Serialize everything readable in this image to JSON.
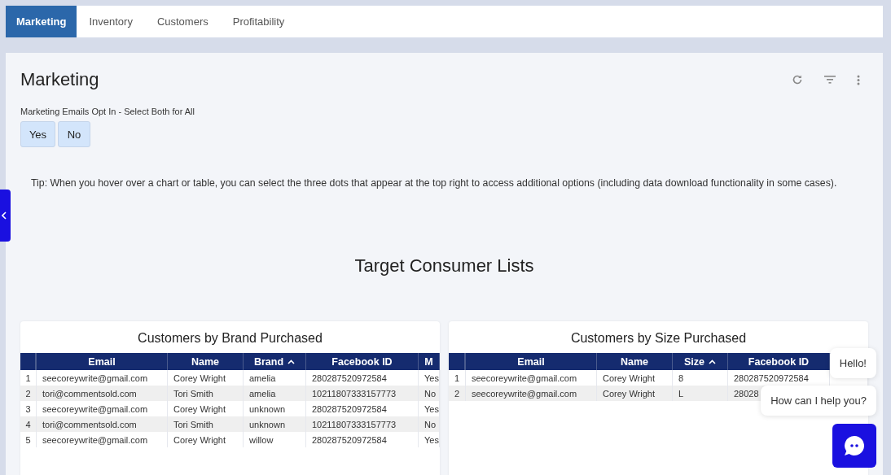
{
  "tabs": [
    {
      "label": "Marketing",
      "selected": true
    },
    {
      "label": "Inventory",
      "selected": false
    },
    {
      "label": "Customers",
      "selected": false
    },
    {
      "label": "Profitability",
      "selected": false
    }
  ],
  "page": {
    "title": "Marketing",
    "filter_label": "Marketing Emails Opt In - Select Both for All",
    "filter_options": [
      {
        "label": "Yes",
        "selected": false
      },
      {
        "label": "No",
        "selected": false
      }
    ],
    "tip": "Tip: When you hover over a chart or table, you can select the three dots that appear at the top right to access additional options (including data download functionality in some cases).",
    "section_title": "Target Consumer Lists"
  },
  "tables": [
    {
      "title": "Customers by Brand Purchased",
      "columns": [
        {
          "sorted": false
        },
        {
          "label": "Email",
          "sorted": false
        },
        {
          "label": "Name",
          "sorted": false
        },
        {
          "label": "Brand",
          "sorted": true
        },
        {
          "label": "Facebook ID",
          "sorted": false
        },
        {
          "label": "M",
          "sorted": false
        }
      ],
      "rows": [
        [
          "1",
          "seecoreywrite@gmail.com",
          "Corey Wright",
          "amelia",
          "280287520972584",
          "Yes"
        ],
        [
          "2",
          "tori@commentsold.com",
          "Tori Smith",
          "amelia",
          "10211807333157773",
          "No"
        ],
        [
          "3",
          "seecoreywrite@gmail.com",
          "Corey Wright",
          "unknown",
          "280287520972584",
          "Yes"
        ],
        [
          "4",
          "tori@commentsold.com",
          "Tori Smith",
          "unknown",
          "10211807333157773",
          "No"
        ],
        [
          "5",
          "seecoreywrite@gmail.com",
          "Corey Wright",
          "willow",
          "280287520972584",
          "Yes"
        ]
      ]
    },
    {
      "title": "Customers by Size Purchased",
      "columns": [
        {
          "sorted": false
        },
        {
          "label": "Email",
          "sorted": false
        },
        {
          "label": "Name",
          "sorted": false
        },
        {
          "label": "Size",
          "sorted": true
        },
        {
          "label": "Facebook ID",
          "sorted": false
        }
      ],
      "rows": [
        [
          "1",
          "seecoreywrite@gmail.com",
          "Corey Wright",
          "8",
          "280287520972584"
        ],
        [
          "2",
          "seecoreywrite@gmail.com",
          "Corey Wright",
          "L",
          "28028"
        ]
      ]
    }
  ],
  "chat": {
    "messages": [
      "Hello!",
      "How can I help you?"
    ]
  }
}
